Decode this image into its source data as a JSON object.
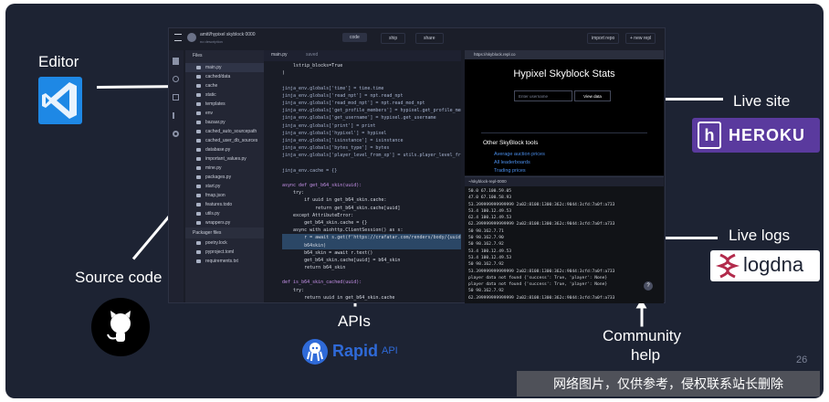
{
  "labels": {
    "editor": "Editor",
    "source_code": "Source code",
    "apis": "APIs",
    "live_site": "Live site",
    "live_logs": "Live logs",
    "community_line1": "Community",
    "community_line2": "help",
    "slide_number": "26"
  },
  "logos": {
    "rapidapi_main": "Rapid",
    "rapidapi_suffix": "API",
    "heroku": "HEROKU",
    "logdna": "logdna"
  },
  "watermark": "网络图片，仅供参考，侵权联系站长删除",
  "colors": {
    "slide_bg": "#1d2333",
    "vscode_blue": "#1e88e5",
    "heroku_purple": "#5a3a9e",
    "logdna_red": "#b22a4b",
    "rapid_blue": "#2f6ad8",
    "link_blue": "#4a8de9"
  },
  "repl": {
    "title": "amitl/hypixel skyblock 0000",
    "subtitle": "no description",
    "tabs": [
      "code",
      "ship",
      "share"
    ],
    "import_button": "import repo",
    "new_button": "+ new repl",
    "files_label": "Files",
    "packager_label": "Packager files",
    "active_file": "main.py",
    "saved_label": "saved",
    "files": [
      "main.py",
      "cached/data",
      "cache",
      "static",
      "templates",
      "env",
      "bazaar.py",
      "cached_auto_sourcepath",
      "cached_user_db_sources",
      "database.py",
      "important_values.py",
      "mine.py",
      "packages.py",
      "start.py",
      "fmap.json",
      "features.todo",
      "utils.py",
      "wrappers.py"
    ],
    "packager_files": [
      "poetry.lock",
      "pyproject.toml",
      "requirements.txt"
    ],
    "code_lines": [
      "    lstrip_blocks=True",
      ")",
      "",
      "jinja_env.globals['time'] = time.time",
      "jinja_env.globals['read_npt'] = npt.read_npt",
      "jinja_env.globals['read_mod_npt'] = npt.read_mod_npt",
      "jinja_env.globals['get_profile_members'] = hypixel.get_profile_members",
      "jinja_env.globals['get_username'] = hypixel.get_username",
      "jinja_env.globals['print'] = print",
      "jinja_env.globals['hypixel'] = hypixel",
      "jinja_env.globals['isinstance'] = isinstance",
      "jinja_env.globals['bytes_type'] = bytes",
      "jinja_env.globals['player_level_from_xp'] = utils.player_level_from_xp",
      "",
      "jinja_env.cache = {}",
      "",
      "async def get_b64_skin(uuid):",
      "    try:",
      "        if uuid in get_b64_skin.cache:",
      "            return get_b64_skin.cache[uuid]",
      "    except AttributeError:",
      "        get_b64_skin.cache = {}",
      "    async with aiohttp.ClientSession() as s:",
      "        r = await s.get(f'https://crafatar.com/renders/body/{uuid}?overlay')",
      "        b64skin)",
      "        b64_skin = await r.text()",
      "        get_b64_skin.cache[uuid] = b64_skin",
      "        return b64_skin",
      "",
      "def is_b64_skin_cached(uuid):",
      "    try:",
      "        return uuid in get_b64_skin.cache",
      "    except AttributeError:",
      "        return False",
      "",
      "async def add_b64_skin_cache(uuid):",
      "    asyncio.ensure_future(get_b64_skin(uuid))"
    ],
    "browser_url": "https://skyblock.repl.co",
    "site_title": "Hypixel Skyblock Stats",
    "username_placeholder": "Enter username",
    "view_button": "View data",
    "tools_heading": "Other SkyBlock tools",
    "tools_links": [
      "Average auction prices",
      "All leaderboards",
      "Trading prices"
    ],
    "console_path": "~/skyblock-repl-0000",
    "console_lines": [
      "50.0 67.100.59.05",
      "47.0 67.100.58.93",
      "53.399999999999999 2a02:8108:1300:362c:9044:3cfd:7a0f:a733",
      "53.4 100.12.49.53",
      "62.4 100.12.49.53",
      "62.399999999999999 2a02:8108:1300:362c:9044:3cfd:7a0f:a733",
      "50 98.162.7.71",
      "50 98.162.7.90",
      "50 98.162.7.92",
      "53.4 100.12.49.53",
      "53.4 100.12.49.53",
      "50 98.162.7.92",
      "53.399999999999999 2a02:8108:1300:362c:9044:3cfd:7a0f:a733",
      "player data not found {'success': True, 'player': None}",
      "player data not found {'success': True, 'player': None}",
      "50 98.162.7.92",
      "62.399999999999999 2a02:8108:1300:362c:9044:3cfd:7a0f:a733"
    ],
    "help_button": "?"
  }
}
